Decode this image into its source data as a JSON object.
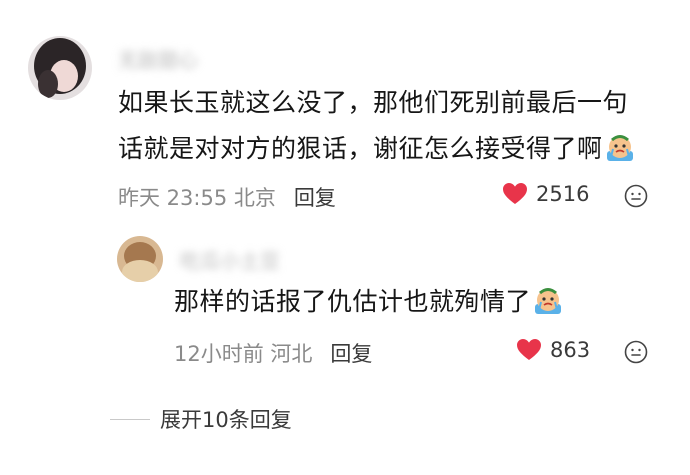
{
  "comments": [
    {
      "username": "无敌甜心",
      "text_line1": "如果长玉就这么没了，那他们死别前最后一句",
      "text_line2": "话就是对对方的狠话，谢征怎么接受得了啊",
      "time_location": "昨天 23:55 北京",
      "reply_label": "回复",
      "likes": "2516",
      "emoji_icon": "crying-face-icon"
    },
    {
      "username": "吃瓜小土豆",
      "text": "那样的话报了仇估计也就殉情了",
      "time_location": "12小时前 河北",
      "reply_label": "回复",
      "likes": "863",
      "emoji_icon": "crying-face-icon"
    }
  ],
  "expand_replies": "展开10条回复",
  "colors": {
    "heart": "#e8344a",
    "meta_text": "#8a8a8a",
    "main_text": "#161616"
  }
}
